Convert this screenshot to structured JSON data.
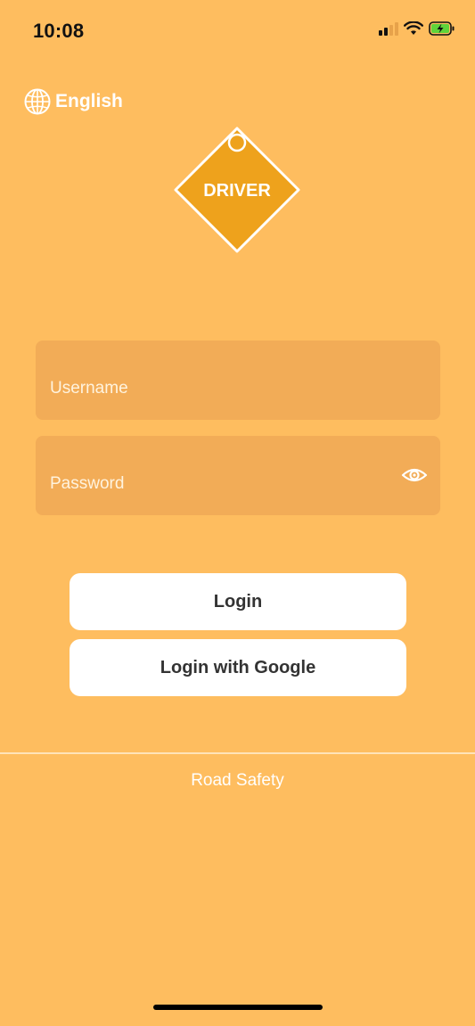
{
  "status_bar": {
    "time": "10:08",
    "icons": [
      "signal-icon",
      "wifi-icon",
      "battery-charging-icon"
    ]
  },
  "language": {
    "label": "English",
    "icon": "globe-icon"
  },
  "logo": {
    "text": "DRIVER",
    "color": "#EEA21C"
  },
  "form": {
    "username": {
      "value": "",
      "placeholder": "Username"
    },
    "password": {
      "value": "",
      "placeholder": "Password",
      "toggle_icon": "eye-icon"
    }
  },
  "buttons": {
    "login": "Login",
    "login_google": "Login with Google"
  },
  "footer": {
    "text": "Road Safety"
  },
  "colors": {
    "background": "#FEBD5F",
    "field": "#F2AC57",
    "button": "#FFFFFF",
    "logo_fill": "#EEA21C"
  }
}
